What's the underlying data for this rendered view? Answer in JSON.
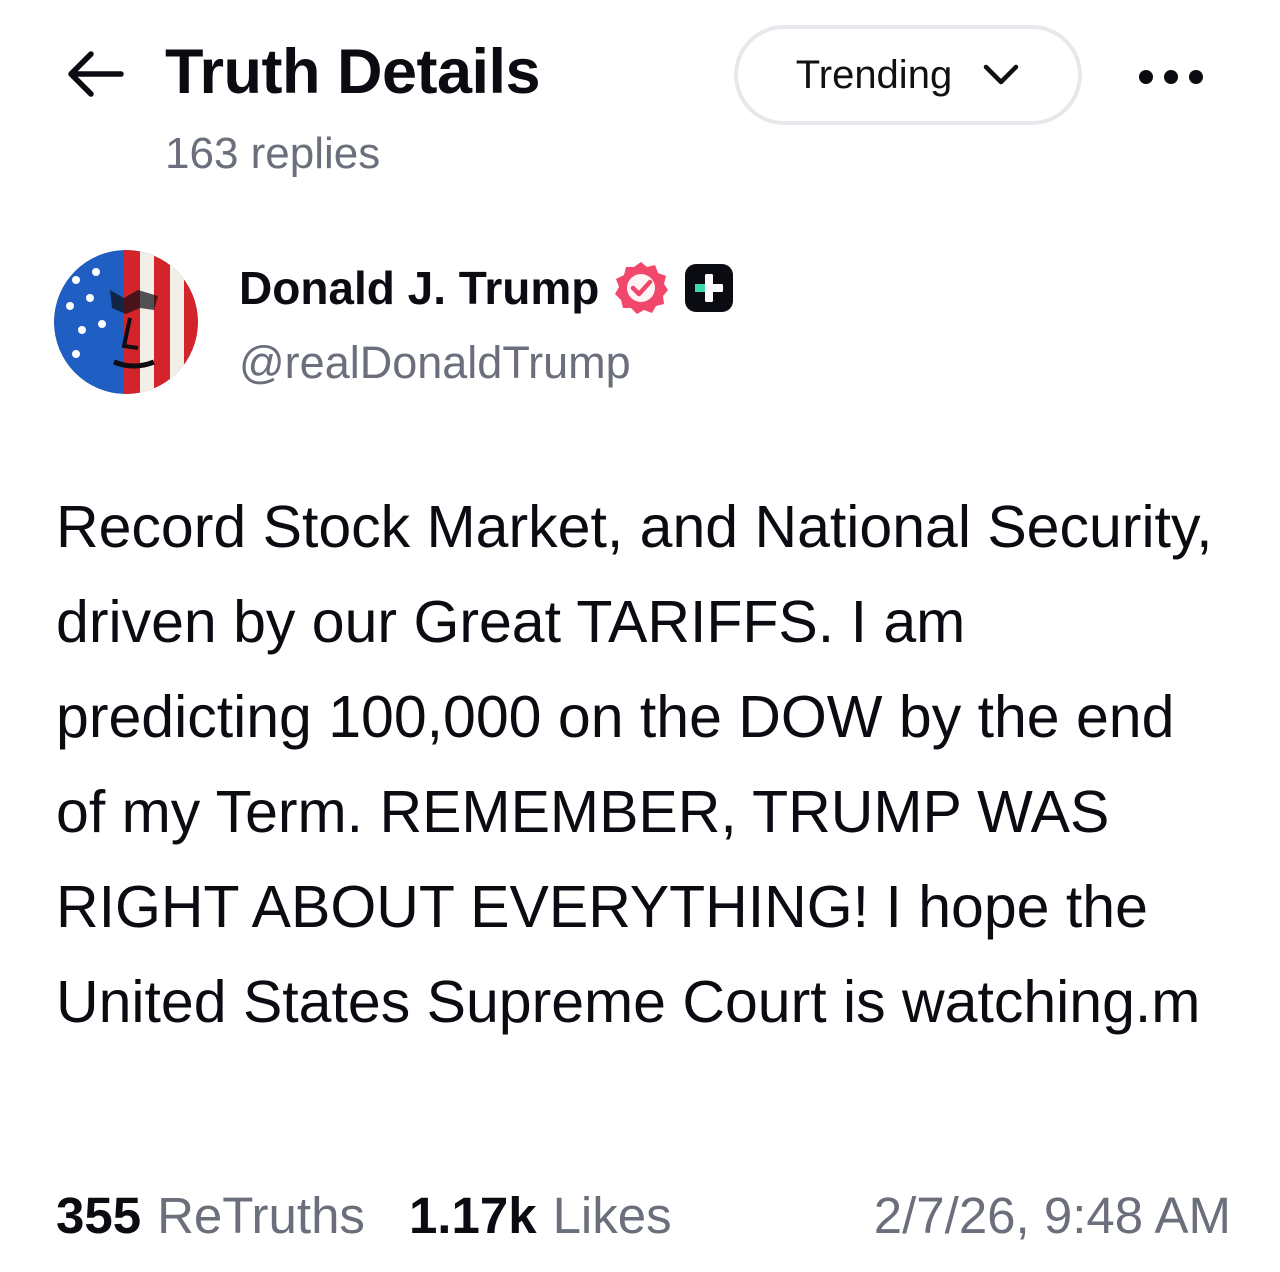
{
  "header": {
    "title": "Truth Details",
    "subtitle": "163 replies",
    "sort_label": "Trending",
    "back_icon": "arrow-left-icon",
    "sort_icon": "chevron-down-icon",
    "more_icon": "more-horizontal-icon"
  },
  "author": {
    "name": "Donald J. Trump",
    "handle": "@realDonaldTrump",
    "verified_color": "#f0476b",
    "avatar_icon": "flag-portrait-avatar"
  },
  "post": {
    "text": "Record Stock Market, and National Security, driven by our Great TARIFFS. I am predicting 100,000 on the DOW by the end of my Term. REMEMBER, TRUMP WAS RIGHT ABOUT EVERYTHING! I hope the United States Supreme Court is watching.m"
  },
  "stats": {
    "retruths_count": "355",
    "retruths_label": "ReTruths",
    "likes_count": "1.17k",
    "likes_label": "Likes",
    "timestamp": "2/7/26, 9:48 AM"
  }
}
